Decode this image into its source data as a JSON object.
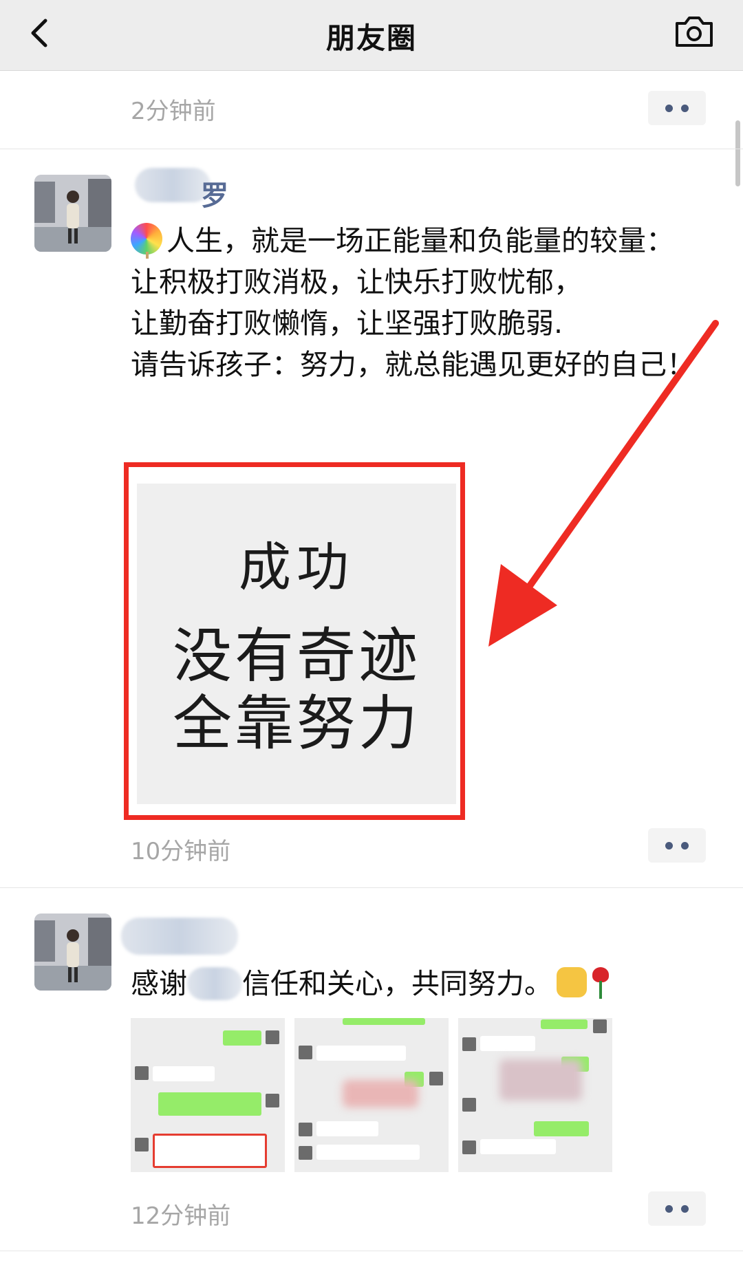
{
  "nav": {
    "title": "朋友圈"
  },
  "icons": {
    "back": "chevron-left-icon",
    "camera": "camera-icon",
    "more": "more-dots-icon",
    "lollipop": "lollipop-emoji",
    "fist": "fist-emoji",
    "rose": "rose-emoji"
  },
  "posts": [
    {
      "time": "2分钟前"
    },
    {
      "name_tail": "罗",
      "text": "人生，就是一场正能量和负能量的较量：\n让积极打败消极，让快乐打败忧郁，\n让勤奋打败懒惰，让坚强打败脆弱.\n请告诉孩子：努力，就总能遇见更好的自己！",
      "image_lines": [
        "成功",
        "没有奇迹",
        "全靠努力"
      ],
      "time": "10分钟前"
    },
    {
      "text_before": "感谢",
      "text_after": "信任和关心，共同努力。",
      "time": "12分钟前"
    }
  ],
  "colors": {
    "nav_bg": "#ededed",
    "time": "#a6a6a6",
    "more_dots": "#4a5a7c",
    "highlight": "#ee2b23",
    "wechat_green": "#95ec69"
  }
}
